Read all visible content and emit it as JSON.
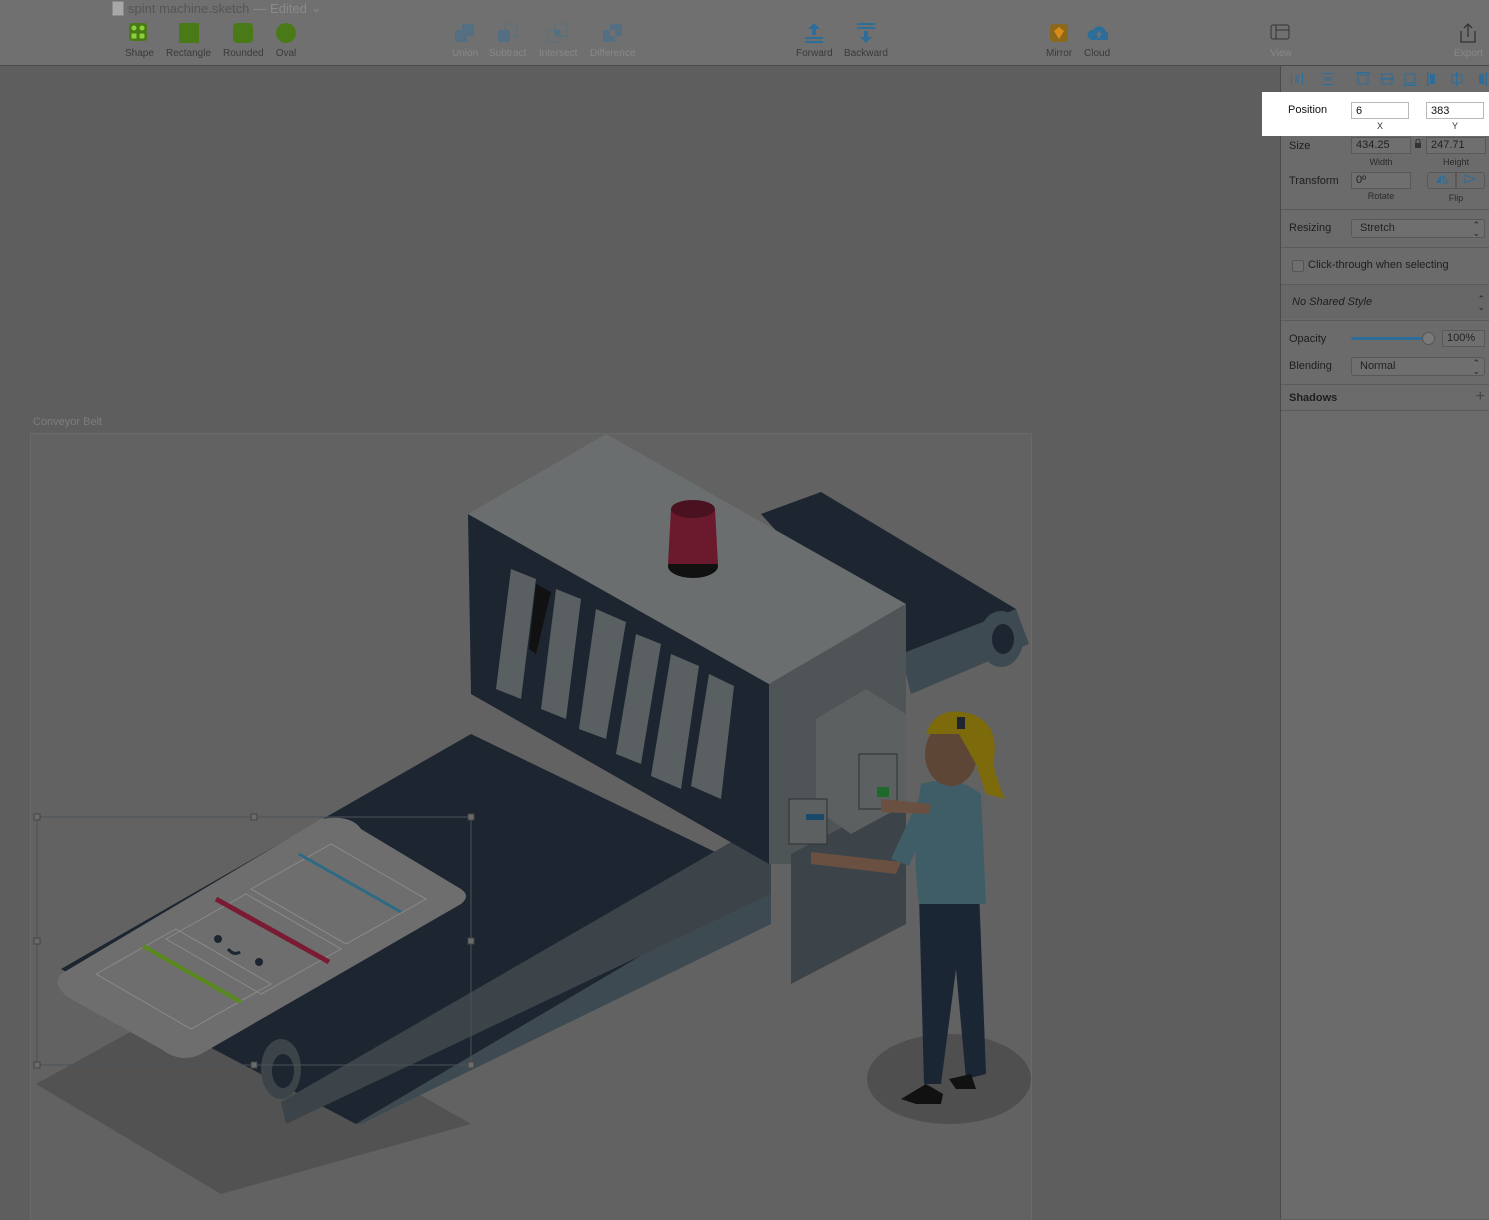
{
  "window": {
    "title": "spint machine.sketch",
    "status": "— Edited"
  },
  "toolbar": {
    "shape": "Shape",
    "rectangle": "Rectangle",
    "rounded": "Rounded",
    "oval": "Oval",
    "union": "Union",
    "subtract": "Subtract",
    "intersect": "Intersect",
    "difference": "Difference",
    "forward": "Forward",
    "backward": "Backward",
    "mirror": "Mirror",
    "cloud": "Cloud",
    "view": "View",
    "export": "Export"
  },
  "canvas": {
    "artboard_name": "Conveyor Belt"
  },
  "inspector": {
    "position": {
      "label": "Position",
      "x": "6",
      "y": "383",
      "x_label": "X",
      "y_label": "Y"
    },
    "size": {
      "label": "Size",
      "width": "434.25",
      "height": "247.71",
      "width_label": "Width",
      "height_label": "Height"
    },
    "transform": {
      "label": "Transform",
      "rotate": "0º",
      "rotate_label": "Rotate",
      "flip_label": "Flip"
    },
    "resizing": {
      "label": "Resizing",
      "value": "Stretch"
    },
    "click_through": {
      "label": "Click-through when selecting",
      "checked": false
    },
    "shared_style": "No Shared Style",
    "opacity": {
      "label": "Opacity",
      "value": "100%",
      "fraction": 1.0
    },
    "blending": {
      "label": "Blending",
      "value": "Normal"
    },
    "shadows": {
      "label": "Shadows"
    }
  },
  "colors": {
    "accent_green": "#5a8a1e",
    "accent_blue": "#3d7fb0",
    "beacon_red": "#6a1a2c",
    "belt_dark": "#1c2530",
    "machine_gray": "#5c6061",
    "hair_yellow": "#7d6a0a",
    "shirt_teal": "#3f5d66"
  }
}
